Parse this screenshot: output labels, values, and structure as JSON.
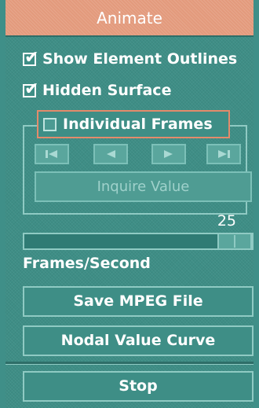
{
  "panel": {
    "title": "Animate"
  },
  "options": {
    "show_element_outlines": {
      "label": "Show Element Outlines",
      "checked": true
    },
    "hidden_surface": {
      "label": "Hidden Surface",
      "checked": true
    }
  },
  "frames_group": {
    "individual_frames": {
      "label": "Individual Frames",
      "checked": false
    },
    "buttons": {
      "first_icon": "skip-to-start-icon",
      "prev_icon": "step-back-icon",
      "next_icon": "step-forward-icon",
      "last_icon": "skip-to-end-icon"
    },
    "inquire_label": "Inquire Value"
  },
  "frame_rate": {
    "value": "25",
    "label": "Frames/Second"
  },
  "actions": {
    "save_mpeg": "Save MPEG File",
    "nodal_curve": "Nodal Value Curve",
    "stop": "Stop"
  },
  "colors": {
    "panel_bg": "#3e8e86",
    "title_bg": "#e39a7c",
    "highlight_border": "#e38b6b",
    "text": "#ffffff"
  }
}
